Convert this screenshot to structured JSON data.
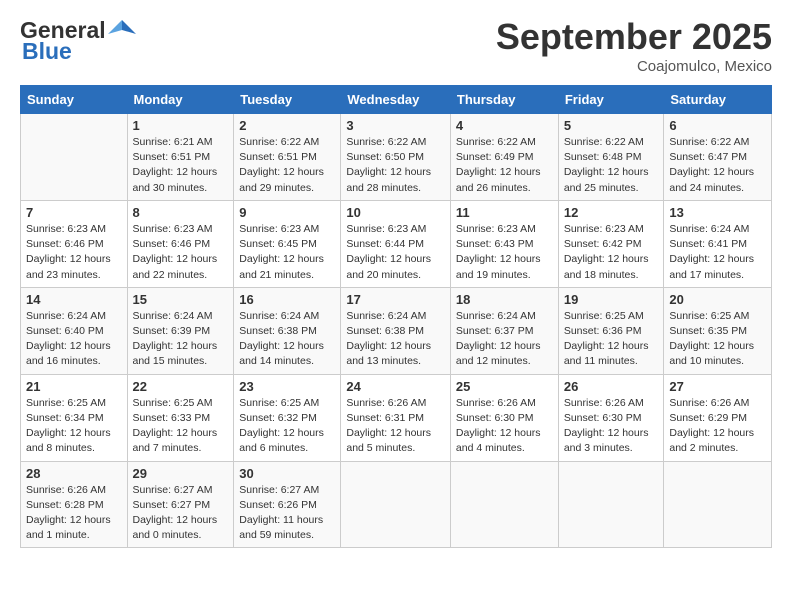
{
  "header": {
    "logo_line1": "General",
    "logo_line2": "Blue",
    "title": "September 2025",
    "subtitle": "Coajomulco, Mexico"
  },
  "columns": [
    "Sunday",
    "Monday",
    "Tuesday",
    "Wednesday",
    "Thursday",
    "Friday",
    "Saturday"
  ],
  "weeks": [
    [
      {
        "day": "",
        "info": ""
      },
      {
        "day": "1",
        "info": "Sunrise: 6:21 AM\nSunset: 6:51 PM\nDaylight: 12 hours\nand 30 minutes."
      },
      {
        "day": "2",
        "info": "Sunrise: 6:22 AM\nSunset: 6:51 PM\nDaylight: 12 hours\nand 29 minutes."
      },
      {
        "day": "3",
        "info": "Sunrise: 6:22 AM\nSunset: 6:50 PM\nDaylight: 12 hours\nand 28 minutes."
      },
      {
        "day": "4",
        "info": "Sunrise: 6:22 AM\nSunset: 6:49 PM\nDaylight: 12 hours\nand 26 minutes."
      },
      {
        "day": "5",
        "info": "Sunrise: 6:22 AM\nSunset: 6:48 PM\nDaylight: 12 hours\nand 25 minutes."
      },
      {
        "day": "6",
        "info": "Sunrise: 6:22 AM\nSunset: 6:47 PM\nDaylight: 12 hours\nand 24 minutes."
      }
    ],
    [
      {
        "day": "7",
        "info": "Sunrise: 6:23 AM\nSunset: 6:46 PM\nDaylight: 12 hours\nand 23 minutes."
      },
      {
        "day": "8",
        "info": "Sunrise: 6:23 AM\nSunset: 6:46 PM\nDaylight: 12 hours\nand 22 minutes."
      },
      {
        "day": "9",
        "info": "Sunrise: 6:23 AM\nSunset: 6:45 PM\nDaylight: 12 hours\nand 21 minutes."
      },
      {
        "day": "10",
        "info": "Sunrise: 6:23 AM\nSunset: 6:44 PM\nDaylight: 12 hours\nand 20 minutes."
      },
      {
        "day": "11",
        "info": "Sunrise: 6:23 AM\nSunset: 6:43 PM\nDaylight: 12 hours\nand 19 minutes."
      },
      {
        "day": "12",
        "info": "Sunrise: 6:23 AM\nSunset: 6:42 PM\nDaylight: 12 hours\nand 18 minutes."
      },
      {
        "day": "13",
        "info": "Sunrise: 6:24 AM\nSunset: 6:41 PM\nDaylight: 12 hours\nand 17 minutes."
      }
    ],
    [
      {
        "day": "14",
        "info": "Sunrise: 6:24 AM\nSunset: 6:40 PM\nDaylight: 12 hours\nand 16 minutes."
      },
      {
        "day": "15",
        "info": "Sunrise: 6:24 AM\nSunset: 6:39 PM\nDaylight: 12 hours\nand 15 minutes."
      },
      {
        "day": "16",
        "info": "Sunrise: 6:24 AM\nSunset: 6:38 PM\nDaylight: 12 hours\nand 14 minutes."
      },
      {
        "day": "17",
        "info": "Sunrise: 6:24 AM\nSunset: 6:38 PM\nDaylight: 12 hours\nand 13 minutes."
      },
      {
        "day": "18",
        "info": "Sunrise: 6:24 AM\nSunset: 6:37 PM\nDaylight: 12 hours\nand 12 minutes."
      },
      {
        "day": "19",
        "info": "Sunrise: 6:25 AM\nSunset: 6:36 PM\nDaylight: 12 hours\nand 11 minutes."
      },
      {
        "day": "20",
        "info": "Sunrise: 6:25 AM\nSunset: 6:35 PM\nDaylight: 12 hours\nand 10 minutes."
      }
    ],
    [
      {
        "day": "21",
        "info": "Sunrise: 6:25 AM\nSunset: 6:34 PM\nDaylight: 12 hours\nand 8 minutes."
      },
      {
        "day": "22",
        "info": "Sunrise: 6:25 AM\nSunset: 6:33 PM\nDaylight: 12 hours\nand 7 minutes."
      },
      {
        "day": "23",
        "info": "Sunrise: 6:25 AM\nSunset: 6:32 PM\nDaylight: 12 hours\nand 6 minutes."
      },
      {
        "day": "24",
        "info": "Sunrise: 6:26 AM\nSunset: 6:31 PM\nDaylight: 12 hours\nand 5 minutes."
      },
      {
        "day": "25",
        "info": "Sunrise: 6:26 AM\nSunset: 6:30 PM\nDaylight: 12 hours\nand 4 minutes."
      },
      {
        "day": "26",
        "info": "Sunrise: 6:26 AM\nSunset: 6:30 PM\nDaylight: 12 hours\nand 3 minutes."
      },
      {
        "day": "27",
        "info": "Sunrise: 6:26 AM\nSunset: 6:29 PM\nDaylight: 12 hours\nand 2 minutes."
      }
    ],
    [
      {
        "day": "28",
        "info": "Sunrise: 6:26 AM\nSunset: 6:28 PM\nDaylight: 12 hours\nand 1 minute."
      },
      {
        "day": "29",
        "info": "Sunrise: 6:27 AM\nSunset: 6:27 PM\nDaylight: 12 hours\nand 0 minutes."
      },
      {
        "day": "30",
        "info": "Sunrise: 6:27 AM\nSunset: 6:26 PM\nDaylight: 11 hours\nand 59 minutes."
      },
      {
        "day": "",
        "info": ""
      },
      {
        "day": "",
        "info": ""
      },
      {
        "day": "",
        "info": ""
      },
      {
        "day": "",
        "info": ""
      }
    ]
  ]
}
